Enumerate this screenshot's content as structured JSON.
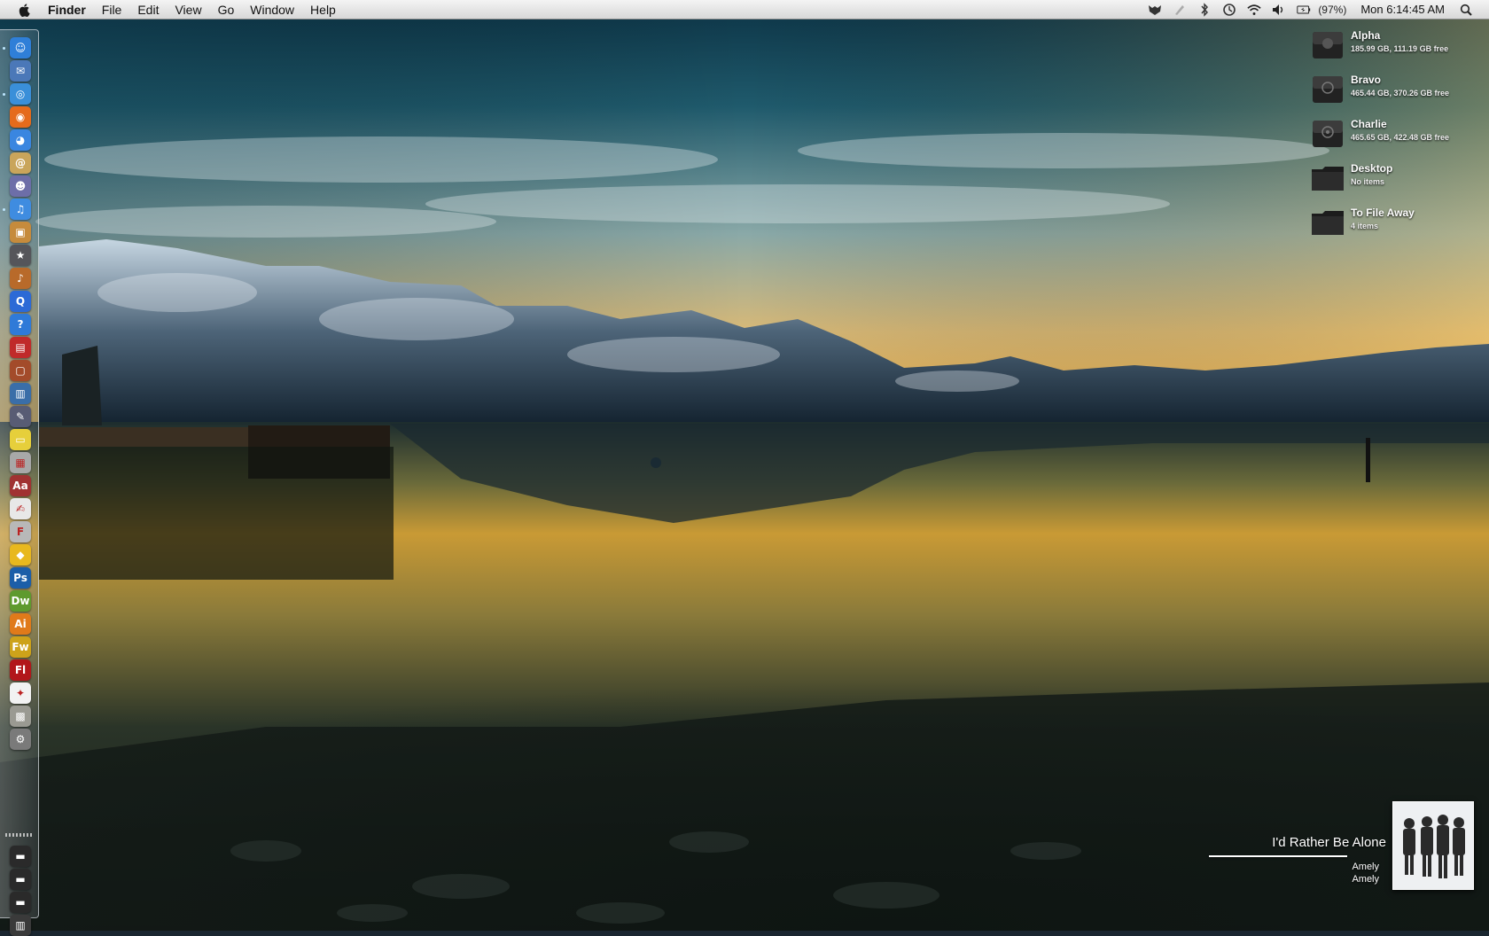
{
  "menubar": {
    "apple_icon": "apple-logo-icon",
    "app_name": "Finder",
    "menus": [
      "File",
      "Edit",
      "View",
      "Go",
      "Window",
      "Help"
    ],
    "status": {
      "icons": [
        "growl-icon",
        "scripts-icon",
        "bluetooth-icon",
        "time-machine-icon",
        "wifi-icon",
        "volume-icon",
        "battery-icon"
      ],
      "battery_percent": "(97%)",
      "clock": "Mon 6:14:45 AM",
      "spotlight_icon": "spotlight-icon"
    }
  },
  "dock": {
    "apps": [
      {
        "name": "finder",
        "color": "#2f7fd8",
        "glyph": "☺",
        "running": true
      },
      {
        "name": "mail-stamp",
        "color": "#4b78b8",
        "glyph": "✉",
        "running": false
      },
      {
        "name": "safari",
        "color": "#3a8fd9",
        "glyph": "◎",
        "running": true
      },
      {
        "name": "firefox",
        "color": "#e56b1c",
        "glyph": "◉",
        "running": false
      },
      {
        "name": "ichat",
        "color": "#3a86e0",
        "glyph": "◕",
        "running": false
      },
      {
        "name": "address-book",
        "color": "#c9a55b",
        "glyph": "@",
        "running": false
      },
      {
        "name": "photo-booth",
        "color": "#6d6ea8",
        "glyph": "☻",
        "running": false
      },
      {
        "name": "itunes",
        "color": "#3f8ce0",
        "glyph": "♫",
        "running": true
      },
      {
        "name": "iphoto",
        "color": "#c68b3c",
        "glyph": "▣",
        "running": false
      },
      {
        "name": "imovie",
        "color": "#55555a",
        "glyph": "★",
        "running": false
      },
      {
        "name": "garageband",
        "color": "#b86a2a",
        "glyph": "♪",
        "running": false
      },
      {
        "name": "quicktime",
        "color": "#2c6ad6",
        "glyph": "Q",
        "running": false
      },
      {
        "name": "preview",
        "color": "#2f7ad8",
        "glyph": "?",
        "running": false
      },
      {
        "name": "photo-app",
        "color": "#c02a2a",
        "glyph": "▤",
        "running": false
      },
      {
        "name": "grab",
        "color": "#a34b2a",
        "glyph": "▢",
        "running": false
      },
      {
        "name": "activity-monitor",
        "color": "#3a6ea8",
        "glyph": "▥",
        "running": false
      },
      {
        "name": "script-editor",
        "color": "#585c74",
        "glyph": "✎",
        "running": false
      },
      {
        "name": "stickies",
        "color": "#e6cf3b",
        "glyph": "▭",
        "running": false
      },
      {
        "name": "calculator",
        "color": "#a8a8a8",
        "glyph": "▦",
        "running": false
      },
      {
        "name": "dictionary",
        "color": "#a03232",
        "glyph": "Aa",
        "running": false
      },
      {
        "name": "textedit",
        "color": "#e8e8e8",
        "glyph": "✍",
        "running": false
      },
      {
        "name": "font-book",
        "color": "#b8b8b8",
        "glyph": "F",
        "running": false
      },
      {
        "name": "adium",
        "color": "#e8b81e",
        "glyph": "◆",
        "running": false
      },
      {
        "name": "photoshop",
        "color": "#1c5ea8",
        "glyph": "Ps",
        "running": false
      },
      {
        "name": "dreamweaver",
        "color": "#5e9a2e",
        "glyph": "Dw",
        "running": false
      },
      {
        "name": "illustrator",
        "color": "#e07a1a",
        "glyph": "Ai",
        "running": false
      },
      {
        "name": "fireworks",
        "color": "#cda21a",
        "glyph": "Fw",
        "running": false
      },
      {
        "name": "flash",
        "color": "#b2171b",
        "glyph": "Fl",
        "running": false
      },
      {
        "name": "acrobat",
        "color": "#f2f2f2",
        "glyph": "✦",
        "running": false
      },
      {
        "name": "installer",
        "color": "#9a9a92",
        "glyph": "▩",
        "running": false
      },
      {
        "name": "system-preferences",
        "color": "#7a7a7a",
        "glyph": "⚙",
        "running": false
      }
    ],
    "stacks": [
      {
        "name": "applications-folder",
        "color": "#2a2a2a",
        "glyph": "▬"
      },
      {
        "name": "documents-folder",
        "color": "#2a2a2a",
        "glyph": "▬"
      },
      {
        "name": "downloads-folder",
        "color": "#2a2a2a",
        "glyph": "▬"
      },
      {
        "name": "trash",
        "color": "#3a3a3a",
        "glyph": "▥"
      }
    ]
  },
  "desktop_items": [
    {
      "name": "Alpha",
      "sub": "185.99 GB, 111.19 GB free",
      "type": "drive"
    },
    {
      "name": "Bravo",
      "sub": "465.44 GB, 370.26 GB free",
      "type": "drive"
    },
    {
      "name": "Charlie",
      "sub": "465.65 GB, 422.48 GB free",
      "type": "drive"
    },
    {
      "name": "Desktop",
      "sub": "No items",
      "type": "folder"
    },
    {
      "name": "To File Away",
      "sub": "4 items",
      "type": "folder"
    }
  ],
  "now_playing": {
    "title": "I'd Rather Be Alone",
    "artist": "Amely",
    "album": "Amely"
  },
  "colors": {
    "sky_top": "#0f3a4a",
    "sunset": "#f0b040",
    "water_dark": "#1d2620",
    "mountain": "#2a3d52"
  }
}
